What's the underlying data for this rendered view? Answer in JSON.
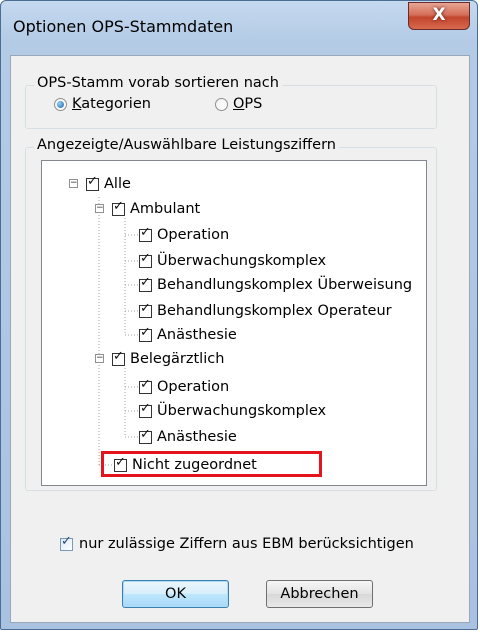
{
  "window": {
    "title": "Optionen OPS-Stammdaten",
    "close_label": "X"
  },
  "sort_group": {
    "label": "OPS-Stamm vorab sortieren nach",
    "options": [
      {
        "label_accel": "K",
        "label_rest": "ategorien",
        "selected": true
      },
      {
        "label_accel": "O",
        "label_rest": "PS",
        "selected": false
      }
    ]
  },
  "digits_group": {
    "label": "Angezeigte/Auswählbare Leistungsziffern"
  },
  "tree": [
    {
      "label": "Alle",
      "level": 0,
      "checked": true,
      "expander": "−"
    },
    {
      "label": "Ambulant",
      "level": 1,
      "checked": true,
      "expander": "−"
    },
    {
      "label": "Operation",
      "level": 2,
      "checked": true
    },
    {
      "label": "Überwachungskomplex",
      "level": 2,
      "checked": true
    },
    {
      "label": "Behandlungskomplex Überweisung",
      "level": 2,
      "checked": true
    },
    {
      "label": "Behandlungskomplex Operateur",
      "level": 2,
      "checked": true
    },
    {
      "label": "Anästhesie",
      "level": 2,
      "checked": true
    },
    {
      "label": "Belegärztlich",
      "level": 1,
      "checked": true,
      "expander": "−"
    },
    {
      "label": "Operation",
      "level": 2,
      "checked": true
    },
    {
      "label": "Überwachungskomplex",
      "level": 2,
      "checked": true
    },
    {
      "label": "Anästhesie",
      "level": 2,
      "checked": true
    },
    {
      "label": "Nicht zugeordnet",
      "level": 1,
      "checked": true
    }
  ],
  "ebm_checkbox": {
    "label": "nur zulässige Ziffern aus EBM berücksichtigen",
    "checked": true
  },
  "buttons": {
    "ok": "OK",
    "cancel": "Abbrechen"
  },
  "colors": {
    "highlight": "#e5141c",
    "close_button": "#c3452c"
  }
}
